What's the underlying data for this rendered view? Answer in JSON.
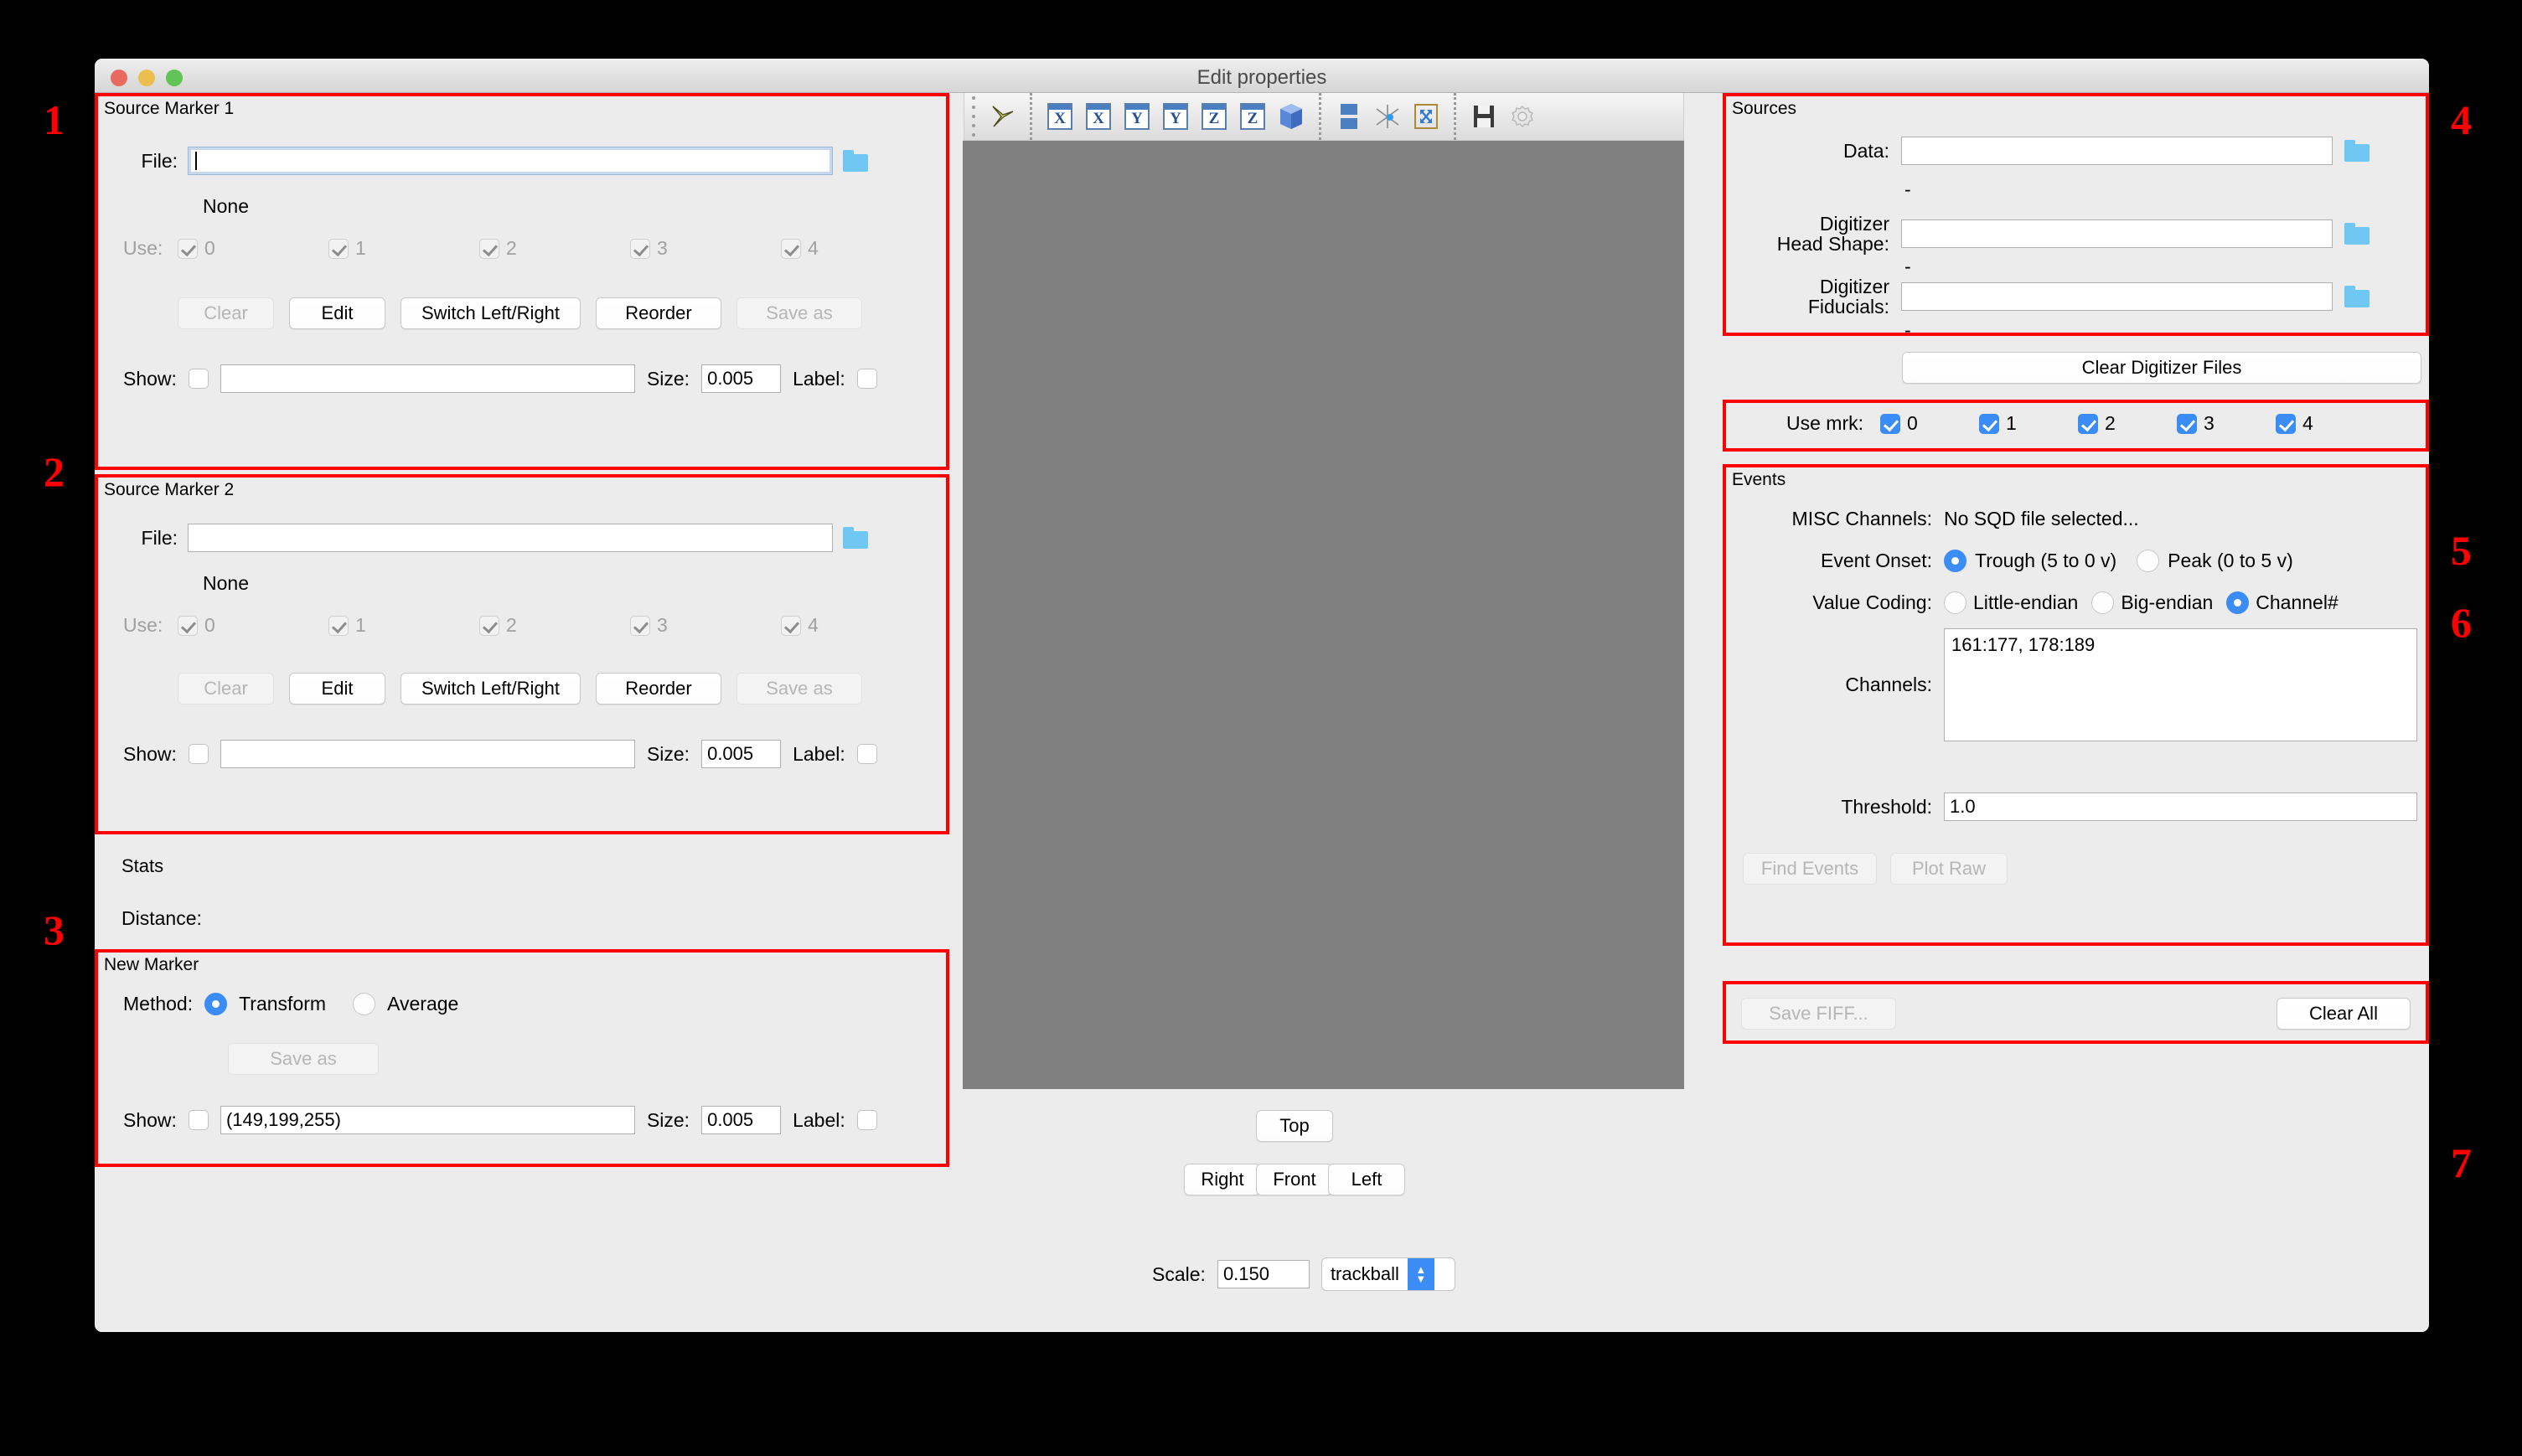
{
  "window": {
    "title": "Edit properties"
  },
  "annotations": [
    "1",
    "2",
    "3",
    "4",
    "5",
    "6",
    "7"
  ],
  "source_marker_1": {
    "title": "Source Marker 1",
    "file_label": "File:",
    "file_value": "",
    "status": "None",
    "use_label": "Use:",
    "use_items": [
      {
        "label": "0",
        "checked": true
      },
      {
        "label": "1",
        "checked": true
      },
      {
        "label": "2",
        "checked": true
      },
      {
        "label": "3",
        "checked": true
      },
      {
        "label": "4",
        "checked": true
      }
    ],
    "buttons": [
      {
        "label": "Clear",
        "enabled": false
      },
      {
        "label": "Edit",
        "enabled": true
      },
      {
        "label": "Switch Left/Right",
        "enabled": true
      },
      {
        "label": "Reorder",
        "enabled": true
      },
      {
        "label": "Save as",
        "enabled": false
      }
    ],
    "show_label": "Show:",
    "show_checked": false,
    "color_value": "",
    "size_label": "Size:",
    "size_value": "0.005",
    "label_label": "Label:",
    "label_checked": false
  },
  "source_marker_2": {
    "title": "Source Marker 2",
    "file_label": "File:",
    "file_value": "",
    "status": "None",
    "use_label": "Use:",
    "use_items": [
      {
        "label": "0",
        "checked": true
      },
      {
        "label": "1",
        "checked": true
      },
      {
        "label": "2",
        "checked": true
      },
      {
        "label": "3",
        "checked": true
      },
      {
        "label": "4",
        "checked": true
      }
    ],
    "buttons": [
      {
        "label": "Clear",
        "enabled": false
      },
      {
        "label": "Edit",
        "enabled": true
      },
      {
        "label": "Switch Left/Right",
        "enabled": true
      },
      {
        "label": "Reorder",
        "enabled": true
      },
      {
        "label": "Save as",
        "enabled": false
      }
    ],
    "show_label": "Show:",
    "show_checked": false,
    "color_value": "",
    "size_label": "Size:",
    "size_value": "0.005",
    "label_label": "Label:",
    "label_checked": false
  },
  "stats": {
    "title": "Stats",
    "distance_label": "Distance:",
    "distance_value": ""
  },
  "new_marker": {
    "title": "New Marker",
    "method_label": "Method:",
    "methods": [
      {
        "label": "Transform",
        "selected": true
      },
      {
        "label": "Average",
        "selected": false
      }
    ],
    "save_as_label": "Save as",
    "save_as_enabled": false,
    "show_label": "Show:",
    "show_checked": false,
    "color_value": "(149,199,255)",
    "size_label": "Size:",
    "size_value": "0.005",
    "label_label": "Label:",
    "label_checked": false
  },
  "toolbar": {
    "icons": [
      {
        "name": "view-orientation-icon",
        "glyph": "axes"
      },
      {
        "name": "view-x-minus-icon",
        "glyph": "X"
      },
      {
        "name": "view-x-plus-icon",
        "glyph": "X"
      },
      {
        "name": "view-y-minus-icon",
        "glyph": "Y"
      },
      {
        "name": "view-y-plus-icon",
        "glyph": "Y"
      },
      {
        "name": "view-z-minus-icon",
        "glyph": "Z"
      },
      {
        "name": "view-z-plus-icon",
        "glyph": "Z"
      },
      {
        "name": "isometric-view-icon",
        "glyph": "cube"
      },
      {
        "name": "split-view-icon",
        "glyph": "split"
      },
      {
        "name": "show-axes-icon",
        "glyph": "axesmark"
      },
      {
        "name": "reset-zoom-icon",
        "glyph": "expand"
      },
      {
        "name": "save-snapshot-icon",
        "glyph": "floppy"
      },
      {
        "name": "settings-gear-icon",
        "glyph": "gear"
      }
    ]
  },
  "view_controls": {
    "top": "Top",
    "right": "Right",
    "front": "Front",
    "left": "Left",
    "scale_label": "Scale:",
    "scale_value": "0.150",
    "mode_value": "trackball"
  },
  "sources": {
    "title": "Sources",
    "data_label": "Data:",
    "data_value": "",
    "data_status": "-",
    "headshape_label": "Digitizer\nHead Shape:",
    "headshape_value": "",
    "headshape_status": "-",
    "fiducials_label": "Digitizer\nFiducials:",
    "fiducials_value": "",
    "fiducials_status": "-",
    "clear_button": "Clear Digitizer Files"
  },
  "use_mrk": {
    "label": "Use mrk:",
    "items": [
      {
        "label": "0",
        "checked": true
      },
      {
        "label": "1",
        "checked": true
      },
      {
        "label": "2",
        "checked": true
      },
      {
        "label": "3",
        "checked": true
      },
      {
        "label": "4",
        "checked": true
      }
    ]
  },
  "events": {
    "title": "Events",
    "misc_label": "MISC Channels:",
    "misc_value": "No SQD file selected...",
    "onset_label": "Event Onset:",
    "onset_options": [
      {
        "label": "Trough (5 to 0 v)",
        "selected": true
      },
      {
        "label": "Peak (0 to 5 v)",
        "selected": false
      }
    ],
    "coding_label": "Value Coding:",
    "coding_options": [
      {
        "label": "Little-endian",
        "selected": false
      },
      {
        "label": "Big-endian",
        "selected": false
      },
      {
        "label": "Channel#",
        "selected": true
      }
    ],
    "channels_label": "Channels:",
    "channels_value": "161:177, 178:189",
    "threshold_label": "Threshold:",
    "threshold_value": "1.0",
    "find_events_label": "Find Events",
    "find_events_enabled": false,
    "plot_raw_label": "Plot Raw",
    "plot_raw_enabled": false
  },
  "footer": {
    "save_fiff_label": "Save FIFF...",
    "save_fiff_enabled": false,
    "clear_all_label": "Clear All",
    "clear_all_enabled": true
  },
  "colors": {
    "accent": "#3b8cf5",
    "annotation": "#ff0000",
    "viewport": "#808080",
    "window_bg": "#ececec"
  }
}
